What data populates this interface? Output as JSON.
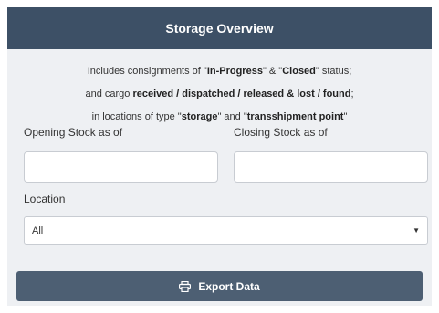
{
  "panel": {
    "title": "Storage Overview",
    "description": {
      "line1": {
        "p1": "Includes consignments of \"",
        "b1": "In-Progress",
        "p2": "\" & \"",
        "b2": "Closed",
        "p3": "\" status;"
      },
      "line2": {
        "p1": "and cargo ",
        "b1": "received / dispatched / released & lost / found",
        "p2": ";"
      },
      "line3": {
        "p1": "in locations of type \"",
        "b1": "storage",
        "p2": "\" and \"",
        "b2": "transshipment point",
        "p3": "\""
      }
    },
    "opening_stock": {
      "label": "Opening Stock as of",
      "value": "",
      "placeholder": ""
    },
    "closing_stock": {
      "label": "Closing Stock as of",
      "value": "",
      "placeholder": ""
    },
    "location": {
      "label": "Location",
      "selected": "All"
    },
    "export_button": {
      "label": "Export Data",
      "icon": "print-icon"
    }
  }
}
